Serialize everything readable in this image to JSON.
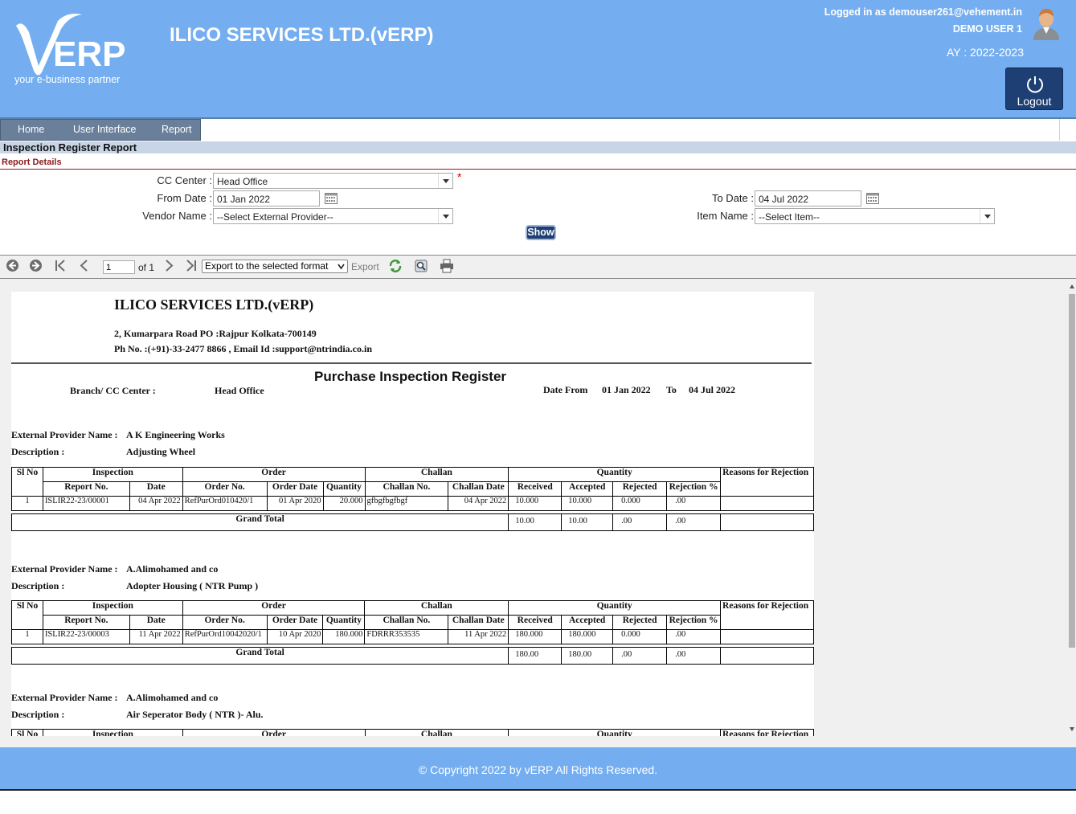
{
  "header": {
    "logo_tagline": "your e-business partner",
    "company_title": "ILICO SERVICES LTD.(vERP)",
    "logged_in": "Logged in as demouser261@vehement.in",
    "user_name": "DEMO USER 1",
    "academic_year": "AY : 2022-2023",
    "logout_label": "Logout"
  },
  "menu": {
    "items": [
      "Home",
      "User Interface",
      "Report"
    ]
  },
  "page": {
    "title": "Inspection Register Report",
    "section": "Report Details"
  },
  "filters": {
    "cc_center_label": "CC Center :",
    "cc_center_value": "Head Office",
    "required_mark": "*",
    "from_date_label": "From Date :",
    "from_date_value": "01 Jan 2022",
    "to_date_label": "To Date :",
    "to_date_value": "04 Jul 2022",
    "vendor_label": "Vendor Name :",
    "vendor_value": "--Select External Provider--",
    "item_label": "Item Name :",
    "item_value": "--Select Item--",
    "show_label": "Show"
  },
  "toolbar": {
    "page_value": "1",
    "of_text": "of 1",
    "export_format": "Export to the selected format",
    "export_link": "Export"
  },
  "report": {
    "company": "ILICO SERVICES LTD.(vERP)",
    "address": "2, Kumarpara Road PO :Rajpur Kolkata-700149",
    "contact": "Ph No. :(+91)-33-2477 8866 , Email Id :support@ntrindia.co.in",
    "title": "Purchase Inspection Register",
    "branch_label": "Branch/ CC Center :",
    "branch_value": "Head Office",
    "date_from_label": "Date From",
    "date_from_value": "01 Jan 2022",
    "to_label": "To",
    "date_to_value": "04 Jul 2022",
    "provider_label": "External Provider Name :",
    "description_label": "Description :",
    "grand_total_label": "Grand Total",
    "headers": {
      "sl_no": "Sl No",
      "inspection": "Inspection",
      "order": "Order",
      "challan": "Challan",
      "quantity": "Quantity",
      "reasons": "Reasons for Rejection",
      "report_no": "Report No.",
      "date": "Date",
      "order_no": "Order No.",
      "order_date": "Order Date",
      "order_qty": "Quantity",
      "challan_no": "Challan No.",
      "challan_date": "Challan Date",
      "received": "Received",
      "accepted": "Accepted",
      "rejected": "Rejected",
      "rejection_pct": "Rejection %"
    },
    "groups": [
      {
        "provider": "A K Engineering Works",
        "description": "Adjusting Wheel",
        "row": {
          "sl": "1",
          "report_no": "ISLIR22-23/00001",
          "date": "04 Apr 2022",
          "order_no": "RefPurOrd010420/1",
          "order_date": "01 Apr 2020",
          "order_qty": "20.000",
          "challan_no": "gfbgfbgfbgf",
          "challan_date": "04 Apr 2022",
          "received": "10.000",
          "accepted": "10.000",
          "rejected": "0.000",
          "rejection_pct": ".00",
          "reason": ""
        },
        "total": {
          "received": "10.00",
          "accepted": "10.00",
          "rejected": ".00",
          "rejection_pct": ".00"
        }
      },
      {
        "provider": "A.Alimohamed and co",
        "description": "Adopter Housing ( NTR Pump )",
        "row": {
          "sl": "1",
          "report_no": "ISLIR22-23/00003",
          "date": "11 Apr 2022",
          "order_no": "RefPurOrd10042020/1",
          "order_date": "10 Apr 2020",
          "order_qty": "180.000",
          "challan_no": "FDRRR353535",
          "challan_date": "11 Apr 2022",
          "received": "180.000",
          "accepted": "180.000",
          "rejected": "0.000",
          "rejection_pct": ".00",
          "reason": ""
        },
        "total": {
          "received": "180.00",
          "accepted": "180.00",
          "rejected": ".00",
          "rejection_pct": ".00"
        }
      },
      {
        "provider": "A.Alimohamed and co",
        "description": "Air Seperator Body ( NTR )- Alu."
      }
    ]
  },
  "footer": {
    "copyright": "© Copyright 2022 by vERP All Rights Reserved."
  }
}
